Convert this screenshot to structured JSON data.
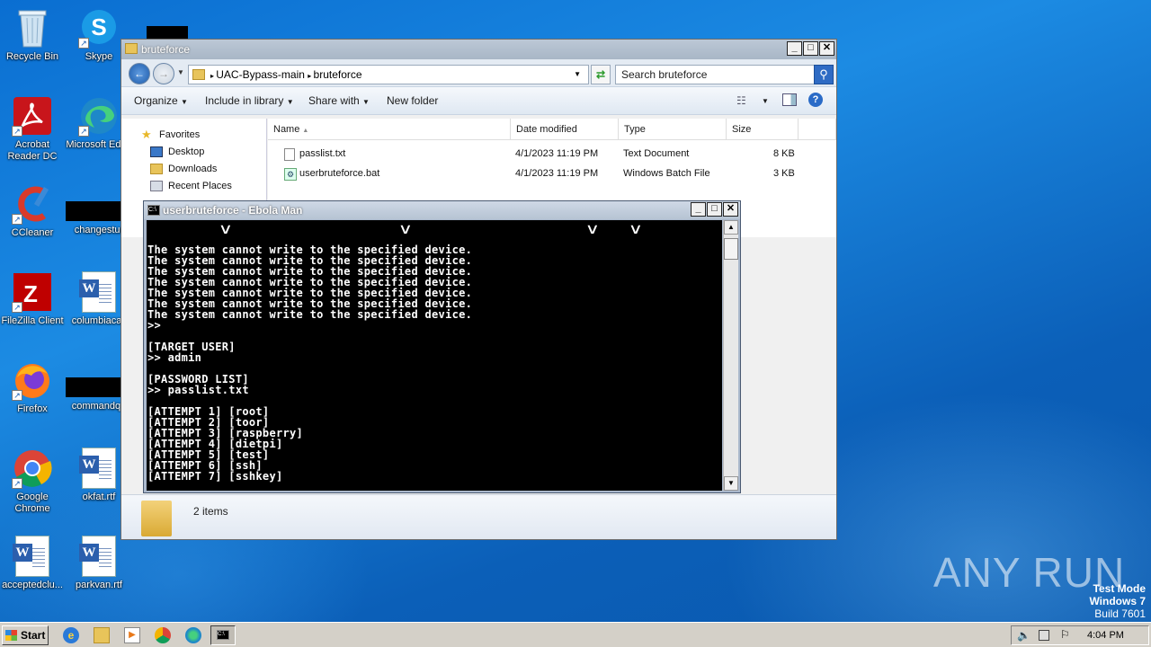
{
  "desktop": {
    "icons": [
      {
        "label": "Recycle Bin"
      },
      {
        "label": "Skype"
      },
      {
        "label": "Acrobat Reader DC"
      },
      {
        "label": "Microsoft Edge"
      },
      {
        "label": "CCleaner"
      },
      {
        "label": "changestur"
      },
      {
        "label": "FileZilla Client"
      },
      {
        "label": "columbiacali"
      },
      {
        "label": "Firefox"
      },
      {
        "label": "commandqu"
      },
      {
        "label": "Google Chrome"
      },
      {
        "label": "okfat.rtf"
      },
      {
        "label": "acceptedclu..."
      },
      {
        "label": "parkvan.rtf"
      }
    ]
  },
  "explorer": {
    "title": "bruteforce",
    "breadcrumb": [
      "UAC-Bypass-main",
      "bruteforce"
    ],
    "search_placeholder": "Search bruteforce",
    "toolbar": {
      "organize": "Organize",
      "include": "Include in library",
      "share": "Share with",
      "new_folder": "New folder"
    },
    "nav": {
      "favorites": "Favorites",
      "desktop": "Desktop",
      "downloads": "Downloads",
      "recent": "Recent Places"
    },
    "columns": {
      "name": "Name",
      "date": "Date modified",
      "type": "Type",
      "size": "Size"
    },
    "files": [
      {
        "name": "passlist.txt",
        "date": "4/1/2023 11:19 PM",
        "type": "Text Document",
        "size": "8 KB"
      },
      {
        "name": "userbruteforce.bat",
        "date": "4/1/2023 11:19 PM",
        "type": "Windows Batch File",
        "size": "3 KB"
      }
    ],
    "status": "2 items"
  },
  "console": {
    "title": "userbruteforce - Ebola Man",
    "lines": [
      "The system cannot write to the specified device.",
      "The system cannot write to the specified device.",
      "The system cannot write to the specified device.",
      "The system cannot write to the specified device.",
      "The system cannot write to the specified device.",
      "The system cannot write to the specified device.",
      "The system cannot write to the specified device.",
      ">>",
      "",
      "[TARGET USER]",
      ">> admin",
      "",
      "[PASSWORD LIST]",
      ">> passlist.txt",
      "",
      "[ATTEMPT 1] [root]",
      "[ATTEMPT 2] [toor]",
      "[ATTEMPT 3] [raspberry]",
      "[ATTEMPT 4] [dietpi]",
      "[ATTEMPT 5] [test]",
      "[ATTEMPT 6] [ssh]",
      "[ATTEMPT 7] [sshkey]"
    ]
  },
  "taskbar": {
    "start": "Start",
    "clock": "4:04 PM"
  },
  "watermark": "ANY RUN",
  "testmode": {
    "line1": "Test Mode",
    "line2": "Windows 7",
    "line3": "Build 7601"
  }
}
